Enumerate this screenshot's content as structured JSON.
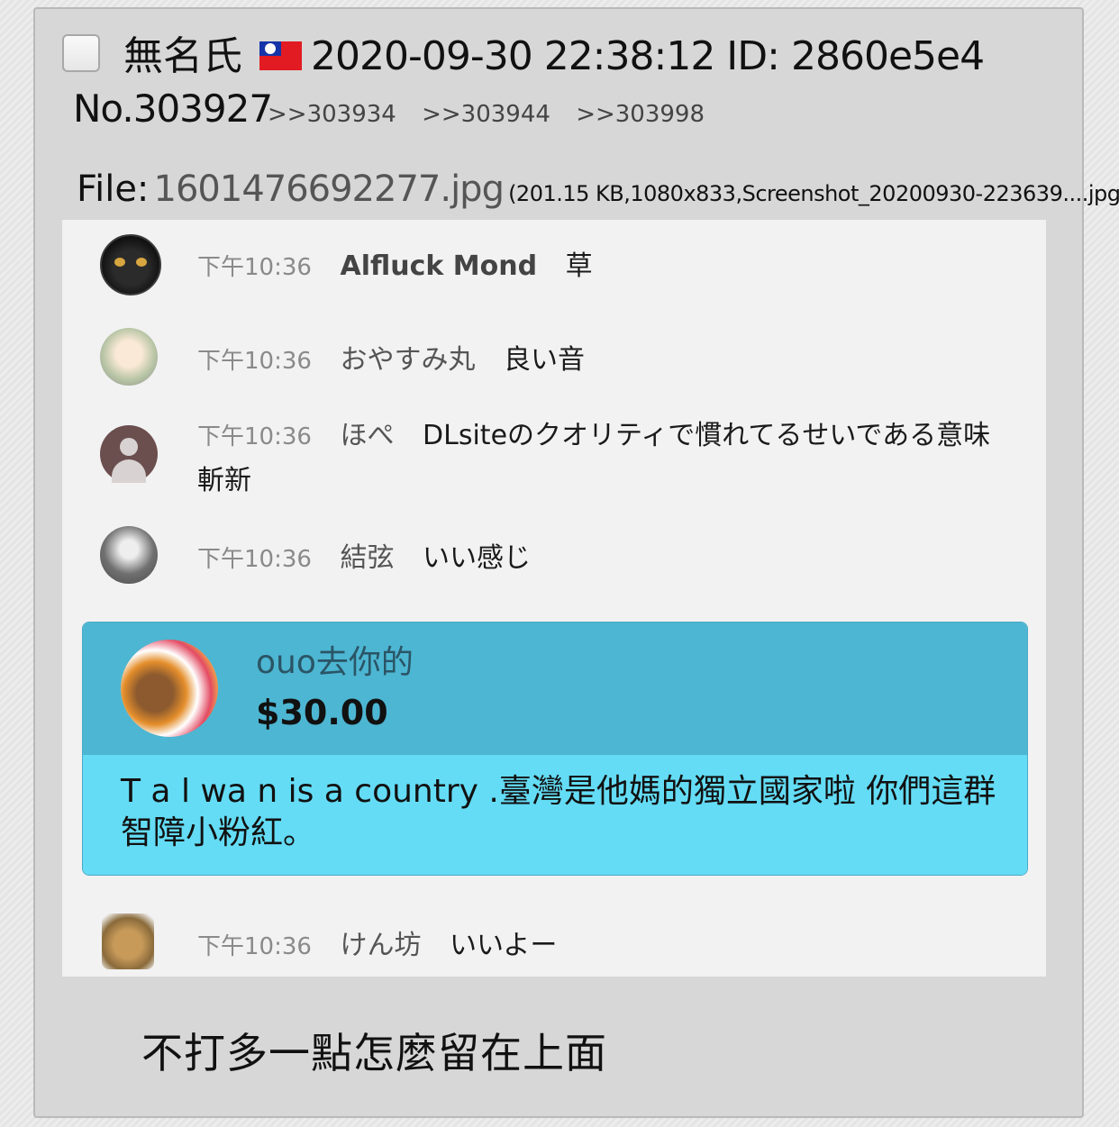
{
  "post": {
    "name": "無名氏",
    "datetime": "2020-09-30 22:38:12 ID: 2860e5e4",
    "number": "No.303927",
    "replies": [
      ">>303934",
      ">>303944",
      ">>303998"
    ],
    "file_label": "File:",
    "file_name": "1601476692277.jpg",
    "file_meta": "(201.15 KB,1080x833,Screenshot_20200930-223639....jpg)",
    "comment": "不打多一點怎麼留在上面"
  },
  "chat": {
    "messages": [
      {
        "time": "下午10:36",
        "author": "Alfluck Mond",
        "text": "草"
      },
      {
        "time": "下午10:36",
        "author": "おやすみ丸",
        "text": "良い音"
      },
      {
        "time": "下午10:36",
        "author": "ほぺ",
        "text": "DLsiteのクオリティで慣れてるせいである意味",
        "text_cont": "斬新"
      },
      {
        "time": "下午10:36",
        "author": "結弦",
        "text": "いい感じ"
      },
      {
        "time": "下午10:36",
        "author": "けん坊",
        "text": "いいよー"
      }
    ],
    "superchat": {
      "author": "ouo去你的",
      "amount": "$30.00",
      "message": "T a l wa n is a country .臺灣是他媽的獨立國家啦 你們這群智障小粉紅。"
    }
  },
  "colors": {
    "superchat_header": "#4db6d2",
    "superchat_body": "#64dcf5",
    "post_background": "#d7d7d7"
  }
}
